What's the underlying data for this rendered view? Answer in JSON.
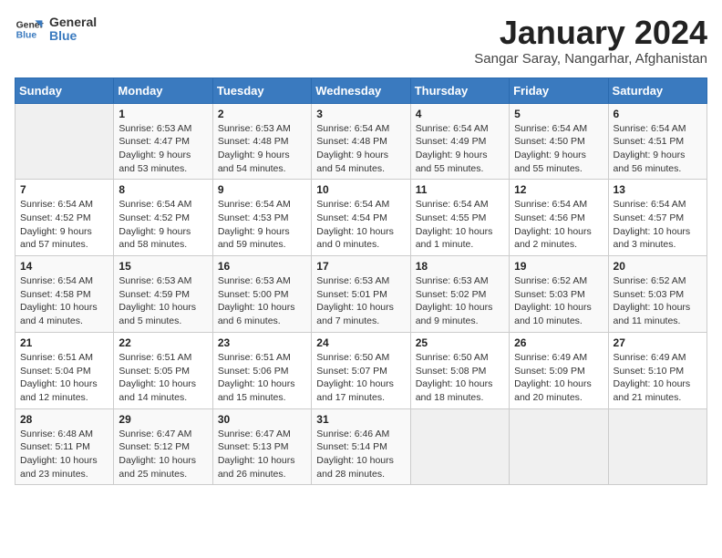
{
  "logo": {
    "line1": "General",
    "line2": "Blue"
  },
  "title": "January 2024",
  "subtitle": "Sangar Saray, Nangarhar, Afghanistan",
  "days_of_week": [
    "Sunday",
    "Monday",
    "Tuesday",
    "Wednesday",
    "Thursday",
    "Friday",
    "Saturday"
  ],
  "weeks": [
    [
      {
        "day": "",
        "sunrise": "",
        "sunset": "",
        "daylight": ""
      },
      {
        "day": "1",
        "sunrise": "Sunrise: 6:53 AM",
        "sunset": "Sunset: 4:47 PM",
        "daylight": "Daylight: 9 hours and 53 minutes."
      },
      {
        "day": "2",
        "sunrise": "Sunrise: 6:53 AM",
        "sunset": "Sunset: 4:48 PM",
        "daylight": "Daylight: 9 hours and 54 minutes."
      },
      {
        "day": "3",
        "sunrise": "Sunrise: 6:54 AM",
        "sunset": "Sunset: 4:48 PM",
        "daylight": "Daylight: 9 hours and 54 minutes."
      },
      {
        "day": "4",
        "sunrise": "Sunrise: 6:54 AM",
        "sunset": "Sunset: 4:49 PM",
        "daylight": "Daylight: 9 hours and 55 minutes."
      },
      {
        "day": "5",
        "sunrise": "Sunrise: 6:54 AM",
        "sunset": "Sunset: 4:50 PM",
        "daylight": "Daylight: 9 hours and 55 minutes."
      },
      {
        "day": "6",
        "sunrise": "Sunrise: 6:54 AM",
        "sunset": "Sunset: 4:51 PM",
        "daylight": "Daylight: 9 hours and 56 minutes."
      }
    ],
    [
      {
        "day": "7",
        "sunrise": "Sunrise: 6:54 AM",
        "sunset": "Sunset: 4:52 PM",
        "daylight": "Daylight: 9 hours and 57 minutes."
      },
      {
        "day": "8",
        "sunrise": "Sunrise: 6:54 AM",
        "sunset": "Sunset: 4:52 PM",
        "daylight": "Daylight: 9 hours and 58 minutes."
      },
      {
        "day": "9",
        "sunrise": "Sunrise: 6:54 AM",
        "sunset": "Sunset: 4:53 PM",
        "daylight": "Daylight: 9 hours and 59 minutes."
      },
      {
        "day": "10",
        "sunrise": "Sunrise: 6:54 AM",
        "sunset": "Sunset: 4:54 PM",
        "daylight": "Daylight: 10 hours and 0 minutes."
      },
      {
        "day": "11",
        "sunrise": "Sunrise: 6:54 AM",
        "sunset": "Sunset: 4:55 PM",
        "daylight": "Daylight: 10 hours and 1 minute."
      },
      {
        "day": "12",
        "sunrise": "Sunrise: 6:54 AM",
        "sunset": "Sunset: 4:56 PM",
        "daylight": "Daylight: 10 hours and 2 minutes."
      },
      {
        "day": "13",
        "sunrise": "Sunrise: 6:54 AM",
        "sunset": "Sunset: 4:57 PM",
        "daylight": "Daylight: 10 hours and 3 minutes."
      }
    ],
    [
      {
        "day": "14",
        "sunrise": "Sunrise: 6:54 AM",
        "sunset": "Sunset: 4:58 PM",
        "daylight": "Daylight: 10 hours and 4 minutes."
      },
      {
        "day": "15",
        "sunrise": "Sunrise: 6:53 AM",
        "sunset": "Sunset: 4:59 PM",
        "daylight": "Daylight: 10 hours and 5 minutes."
      },
      {
        "day": "16",
        "sunrise": "Sunrise: 6:53 AM",
        "sunset": "Sunset: 5:00 PM",
        "daylight": "Daylight: 10 hours and 6 minutes."
      },
      {
        "day": "17",
        "sunrise": "Sunrise: 6:53 AM",
        "sunset": "Sunset: 5:01 PM",
        "daylight": "Daylight: 10 hours and 7 minutes."
      },
      {
        "day": "18",
        "sunrise": "Sunrise: 6:53 AM",
        "sunset": "Sunset: 5:02 PM",
        "daylight": "Daylight: 10 hours and 9 minutes."
      },
      {
        "day": "19",
        "sunrise": "Sunrise: 6:52 AM",
        "sunset": "Sunset: 5:03 PM",
        "daylight": "Daylight: 10 hours and 10 minutes."
      },
      {
        "day": "20",
        "sunrise": "Sunrise: 6:52 AM",
        "sunset": "Sunset: 5:03 PM",
        "daylight": "Daylight: 10 hours and 11 minutes."
      }
    ],
    [
      {
        "day": "21",
        "sunrise": "Sunrise: 6:51 AM",
        "sunset": "Sunset: 5:04 PM",
        "daylight": "Daylight: 10 hours and 12 minutes."
      },
      {
        "day": "22",
        "sunrise": "Sunrise: 6:51 AM",
        "sunset": "Sunset: 5:05 PM",
        "daylight": "Daylight: 10 hours and 14 minutes."
      },
      {
        "day": "23",
        "sunrise": "Sunrise: 6:51 AM",
        "sunset": "Sunset: 5:06 PM",
        "daylight": "Daylight: 10 hours and 15 minutes."
      },
      {
        "day": "24",
        "sunrise": "Sunrise: 6:50 AM",
        "sunset": "Sunset: 5:07 PM",
        "daylight": "Daylight: 10 hours and 17 minutes."
      },
      {
        "day": "25",
        "sunrise": "Sunrise: 6:50 AM",
        "sunset": "Sunset: 5:08 PM",
        "daylight": "Daylight: 10 hours and 18 minutes."
      },
      {
        "day": "26",
        "sunrise": "Sunrise: 6:49 AM",
        "sunset": "Sunset: 5:09 PM",
        "daylight": "Daylight: 10 hours and 20 minutes."
      },
      {
        "day": "27",
        "sunrise": "Sunrise: 6:49 AM",
        "sunset": "Sunset: 5:10 PM",
        "daylight": "Daylight: 10 hours and 21 minutes."
      }
    ],
    [
      {
        "day": "28",
        "sunrise": "Sunrise: 6:48 AM",
        "sunset": "Sunset: 5:11 PM",
        "daylight": "Daylight: 10 hours and 23 minutes."
      },
      {
        "day": "29",
        "sunrise": "Sunrise: 6:47 AM",
        "sunset": "Sunset: 5:12 PM",
        "daylight": "Daylight: 10 hours and 25 minutes."
      },
      {
        "day": "30",
        "sunrise": "Sunrise: 6:47 AM",
        "sunset": "Sunset: 5:13 PM",
        "daylight": "Daylight: 10 hours and 26 minutes."
      },
      {
        "day": "31",
        "sunrise": "Sunrise: 6:46 AM",
        "sunset": "Sunset: 5:14 PM",
        "daylight": "Daylight: 10 hours and 28 minutes."
      },
      {
        "day": "",
        "sunrise": "",
        "sunset": "",
        "daylight": ""
      },
      {
        "day": "",
        "sunrise": "",
        "sunset": "",
        "daylight": ""
      },
      {
        "day": "",
        "sunrise": "",
        "sunset": "",
        "daylight": ""
      }
    ]
  ]
}
